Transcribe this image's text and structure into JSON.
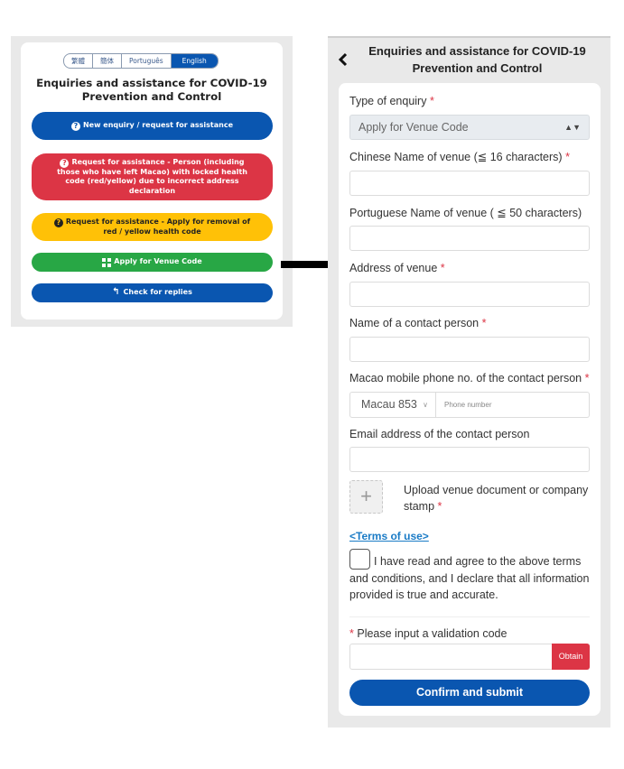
{
  "left": {
    "languages": [
      {
        "label": "繁體",
        "active": false
      },
      {
        "label": "簡体",
        "active": false
      },
      {
        "label": "Português",
        "active": false
      },
      {
        "label": "English",
        "active": true
      }
    ],
    "title": "Enquiries and assistance for COVID-19 Prevention and Control",
    "buttons": {
      "new_enquiry": {
        "icon": "question-circle-icon",
        "label": "New enquiry / request for assistance",
        "color": "#0a56b0"
      },
      "locked_code": {
        "icon": "question-circle-icon",
        "label": "Request for assistance - Person (including those who have left Macao) with locked health code (red/yellow) due to incorrect address declaration",
        "color": "#dc3545"
      },
      "removal": {
        "icon": "question-circle-icon",
        "label": "Request for assistance - Apply for removal of red / yellow health code",
        "color": "#ffc107"
      },
      "venue_code": {
        "icon": "qr-code-icon",
        "label": "Apply for Venue Code",
        "color": "#28a745"
      },
      "check_replies": {
        "icon": "reply-icon",
        "label": "Check for replies",
        "color": "#0a56b0"
      }
    }
  },
  "right": {
    "header": {
      "back_icon": "chevron-left-icon",
      "title": "Enquiries and assistance for COVID-19 Prevention and Control"
    },
    "form": {
      "type_label": "Type of enquiry",
      "type_value": "Apply for Venue Code",
      "chinese_name_label": "Chinese Name of venue (≦ 16 characters)",
      "chinese_name_value": "",
      "portuguese_name_label": "Portuguese Name of venue ( ≦ 50 characters)",
      "portuguese_name_value": "",
      "address_label": "Address of venue",
      "address_value": "",
      "contact_label": "Name of a contact person",
      "contact_value": "",
      "phone_label": "Macao mobile phone no. of the contact person",
      "phone_country": "Macau 853",
      "phone_placeholder": "Phone number",
      "email_label": "Email address of the contact person",
      "email_value": "",
      "upload_label": "Upload venue document or company stamp",
      "terms_link": "<Terms of use>",
      "agree_text": "I have read and agree to the above terms and conditions, and I declare that all information provided is true and accurate.",
      "agree_checked": false,
      "captcha_label": "Please input a validation code",
      "captcha_value": "",
      "obtain_label": "Obtain",
      "submit_label": "Confirm and submit",
      "required_mark": "*"
    }
  }
}
